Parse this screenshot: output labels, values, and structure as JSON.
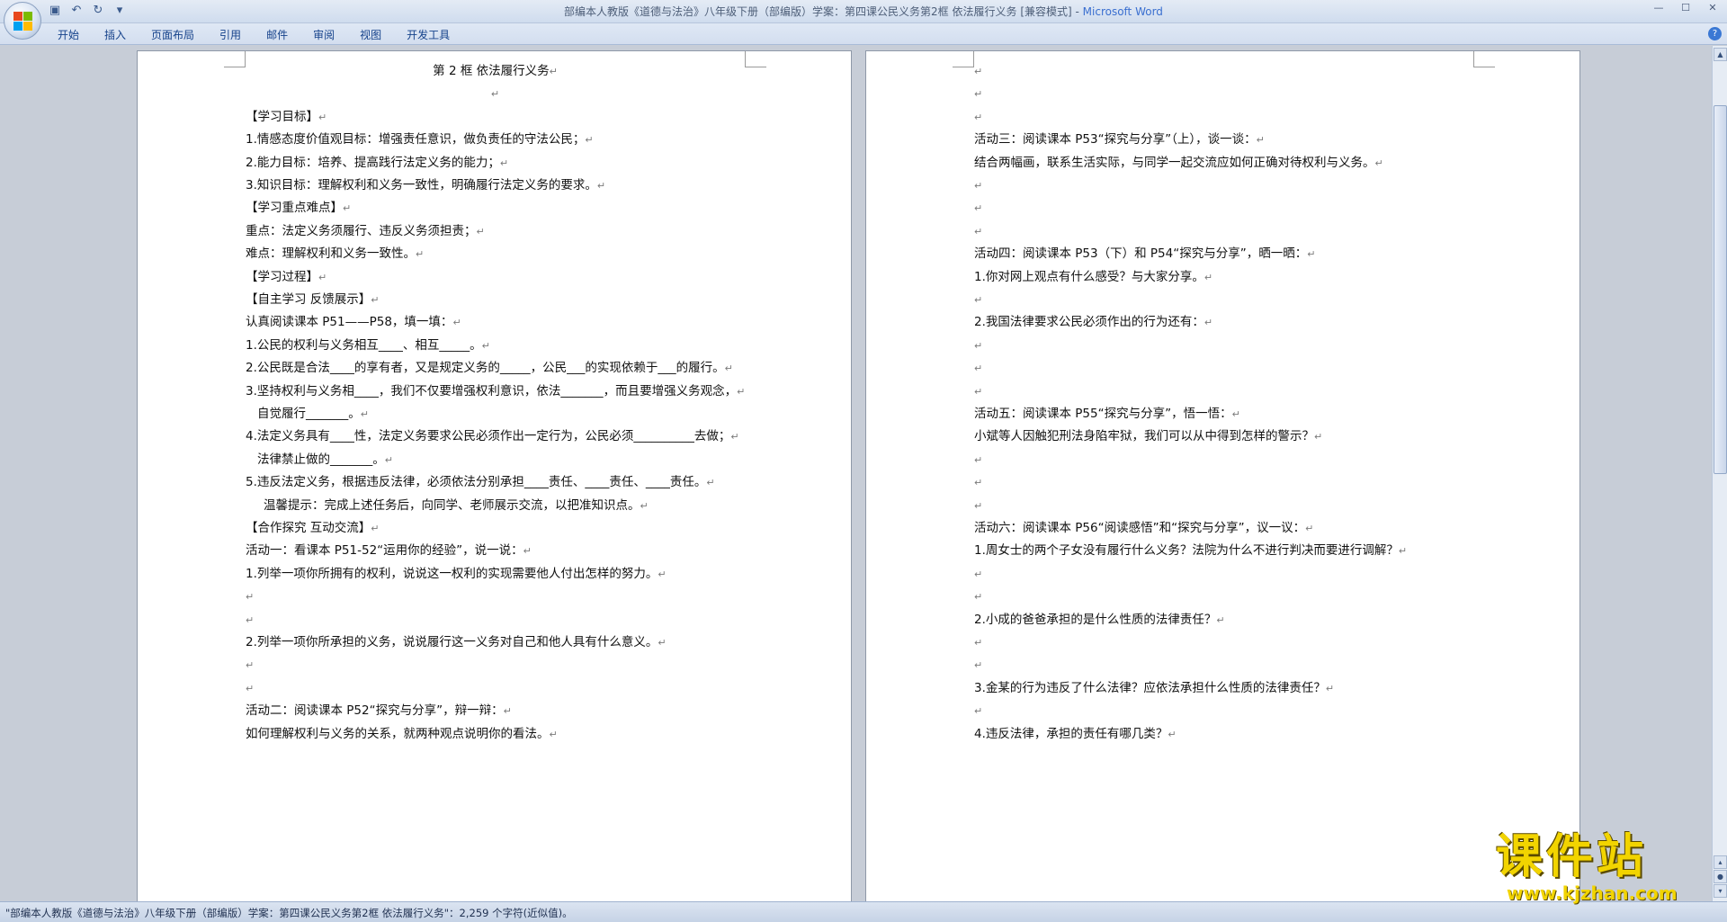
{
  "window": {
    "title": "部编本人教版《道德与法治》八年级下册（部编版）学案：第四课公民义务第2框 依法履行义务 [兼容模式] -",
    "app_name": "Microsoft Word",
    "qat_icons": [
      "save-icon",
      "undo-icon",
      "redo-icon",
      "customize-icon"
    ],
    "controls": [
      "minimize-icon",
      "maximize-icon",
      "close-icon"
    ]
  },
  "ribbon": {
    "tabs": [
      "开始",
      "插入",
      "页面布局",
      "引用",
      "邮件",
      "审阅",
      "视图",
      "开发工具"
    ],
    "help": "?"
  },
  "page1": {
    "lines": [
      "第 2 框  依法履行义务",
      "",
      "【学习目标】",
      "1.情感态度价值观目标：增强责任意识，做负责任的守法公民；",
      "2.能力目标：培养、提高践行法定义务的能力；",
      "3.知识目标：理解权利和义务一致性，明确履行法定义务的要求。",
      "【学习重点难点】",
      "重点：法定义务须履行、违反义务须担责；",
      "难点：理解权利和义务一致性。",
      "【学习过程】",
      "【自主学习  反馈展示】",
      "认真阅读课本 P51——P58，填一填：",
      "1.公民的权利与义务相互____、相互_____。",
      "2.公民既是合法____的享有者，又是规定义务的_____，公民___的实现依赖于___的履行。",
      "3.坚持权利与义务相____，我们不仅要增强权利意识，依法_______，而且要增强义务观念，",
      "自觉履行_______。",
      "4.法定义务具有____性，法定义务要求公民必须作出一定行为，公民必须__________去做；",
      "法律禁止做的_______。",
      "5.违反法定义务，根据违反法律，必须依法分别承担____责任、____责任、____责任。",
      "温馨提示：完成上述任务后，向同学、老师展示交流，以把准知识点。",
      "【合作探究  互动交流】",
      "活动一：看课本 P51-52“运用你的经验”，说一说：",
      "1.列举一项你所拥有的权利，说说这一权利的实现需要他人付出怎样的努力。",
      "",
      "",
      "2.列举一项你所承担的义务，说说履行这一义务对自己和他人具有什么意义。",
      "",
      "",
      "活动二：阅读课本 P52“探究与分享”，辩一辩：",
      "如何理解权利与义务的关系，就两种观点说明你的看法。"
    ]
  },
  "page2": {
    "lines": [
      "",
      "",
      "",
      "活动三：阅读课本 P53“探究与分享”（上），谈一谈：",
      "结合两幅画，联系生活实际，与同学一起交流应如何正确对待权利与义务。",
      "",
      "",
      "",
      "活动四：阅读课本 P53（下）和 P54“探究与分享”，晒一晒：",
      "1.你对网上观点有什么感受？与大家分享。",
      "",
      "2.我国法律要求公民必须作出的行为还有：",
      "",
      "",
      "",
      "活动五：阅读课本 P55“探究与分享”，悟一悟：",
      "小斌等人因触犯刑法身陷牢狱，我们可以从中得到怎样的警示？",
      "",
      "",
      "",
      "活动六：阅读课本 P56“阅读感悟”和“探究与分享”，议一议：",
      "1.周女士的两个子女没有履行什么义务？法院为什么不进行判决而要进行调解？",
      "",
      "",
      "2.小成的爸爸承担的是什么性质的法律责任？",
      "",
      "",
      "3.金某的行为违反了什么法律？应依法承担什么性质的法律责任？",
      "",
      "4.违反法律，承担的责任有哪几类？"
    ]
  },
  "paragraph_mark": "↵",
  "status": {
    "text": "\"部编本人教版《道德与法治》八年级下册（部编版）学案：第四课公民义务第2框  依法履行义务\"：2,259 个字符(近似值)。"
  },
  "watermark": {
    "text": "课件站",
    "url": "www.kjzhan.com"
  }
}
